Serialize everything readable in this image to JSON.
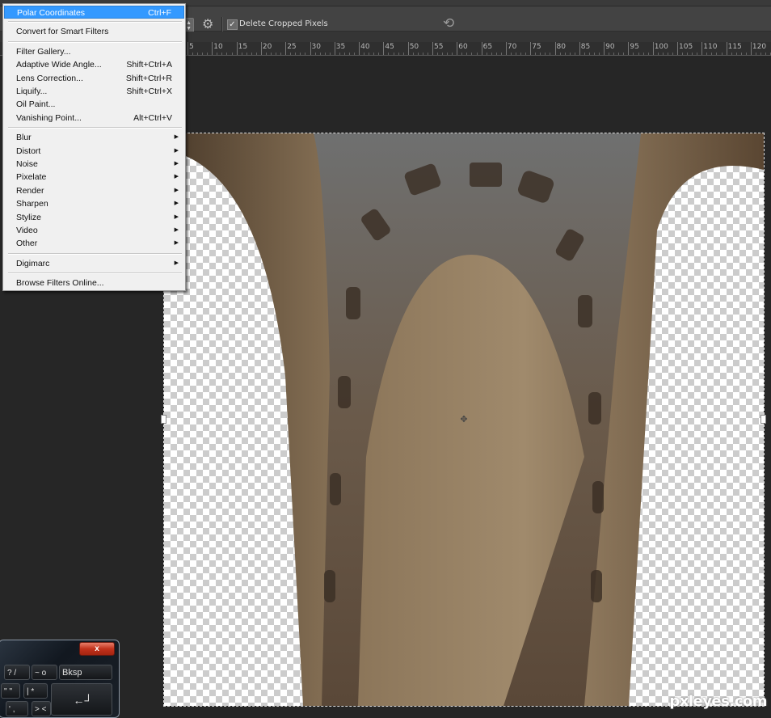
{
  "options_bar": {
    "delete_cropped_label": "Delete Cropped Pixels",
    "delete_cropped_checked": true
  },
  "ruler": {
    "labels": [
      "5",
      "10",
      "15",
      "20",
      "25",
      "30",
      "35",
      "40",
      "45",
      "50",
      "55",
      "60",
      "65",
      "70",
      "75",
      "80",
      "85",
      "90",
      "95",
      "100",
      "105",
      "110",
      "115",
      "120"
    ]
  },
  "filter_menu": {
    "items": [
      {
        "label": "Polar Coordinates",
        "shortcut": "Ctrl+F",
        "highlighted": true
      },
      {
        "separator": true
      },
      {
        "label": "Convert for Smart Filters"
      },
      {
        "separator": true
      },
      {
        "label": "Filter Gallery..."
      },
      {
        "label": "Adaptive Wide Angle...",
        "shortcut": "Shift+Ctrl+A"
      },
      {
        "label": "Lens Correction...",
        "shortcut": "Shift+Ctrl+R"
      },
      {
        "label": "Liquify...",
        "shortcut": "Shift+Ctrl+X"
      },
      {
        "label": "Oil Paint..."
      },
      {
        "label": "Vanishing Point...",
        "shortcut": "Alt+Ctrl+V"
      },
      {
        "separator": true
      },
      {
        "label": "Blur",
        "submenu": true
      },
      {
        "label": "Distort",
        "submenu": true
      },
      {
        "label": "Noise",
        "submenu": true
      },
      {
        "label": "Pixelate",
        "submenu": true
      },
      {
        "label": "Render",
        "submenu": true
      },
      {
        "label": "Sharpen",
        "submenu": true
      },
      {
        "label": "Stylize",
        "submenu": true
      },
      {
        "label": "Video",
        "submenu": true
      },
      {
        "label": "Other",
        "submenu": true
      },
      {
        "separator": true
      },
      {
        "label": "Digimarc",
        "submenu": true
      },
      {
        "separator": true
      },
      {
        "label": "Browse Filters Online..."
      }
    ]
  },
  "onscreen_keyboard": {
    "close_label": "x",
    "keys": [
      "?  /",
      "~  o",
      "Bksp",
      "\"  ''",
      "|  *",
      "←┘",
      "'  ,",
      ">  <"
    ]
  },
  "watermark": "pxleyes.com"
}
